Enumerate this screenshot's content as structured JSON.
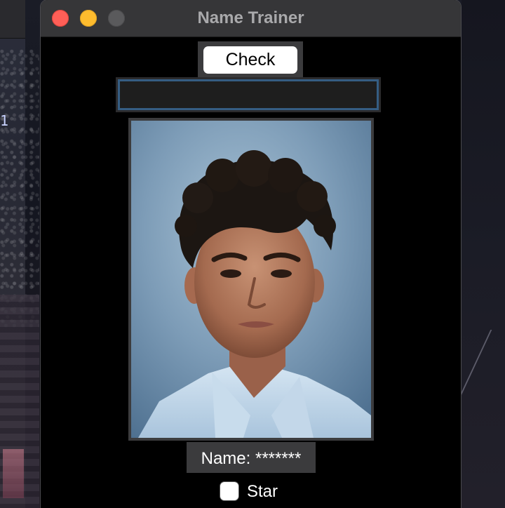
{
  "window": {
    "title": "Name Trainer"
  },
  "background": {
    "editor_line_number": "1"
  },
  "check_button": {
    "label": "Check"
  },
  "name_input": {
    "value": "",
    "placeholder": ""
  },
  "photo": {
    "subject": "student-portrait-photo"
  },
  "name_label": {
    "text": "Name: *******"
  },
  "star_option": {
    "label": "Star",
    "checked": false
  },
  "colors": {
    "close": "#ff5f57",
    "minimize": "#febc2e",
    "zoom_disabled": "#5a5a5c",
    "input_focus_border": "#355d83",
    "window_background": "#000000"
  }
}
